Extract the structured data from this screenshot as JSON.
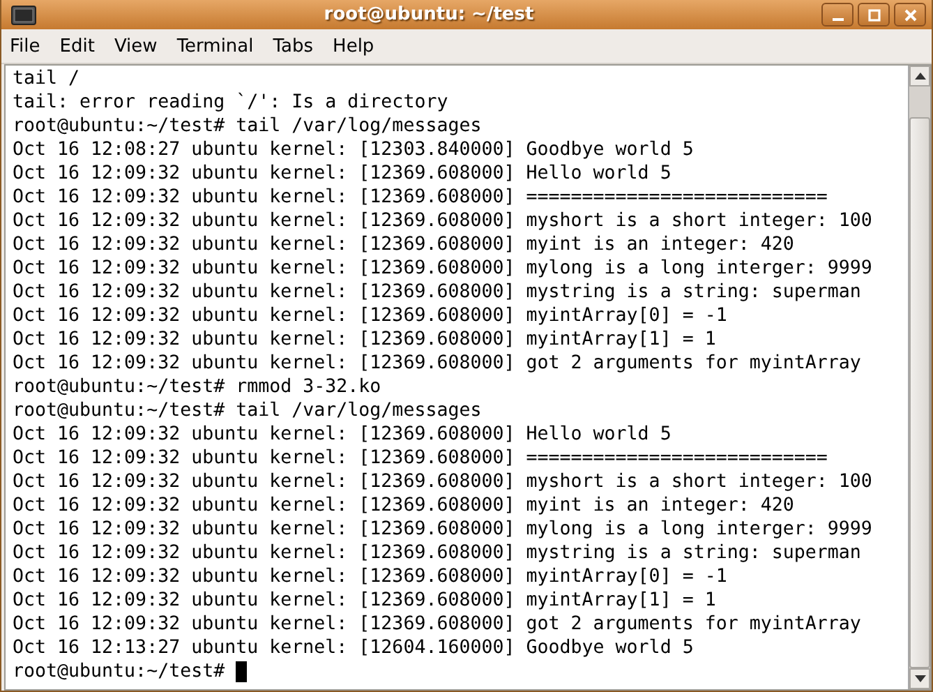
{
  "window": {
    "title": "root@ubuntu: ~/test"
  },
  "menu": [
    {
      "label": "File"
    },
    {
      "label": "Edit"
    },
    {
      "label": "View"
    },
    {
      "label": "Terminal"
    },
    {
      "label": "Tabs"
    },
    {
      "label": "Help"
    }
  ],
  "terminal": {
    "lines": [
      "tail /",
      "tail: error reading `/': Is a directory",
      "root@ubuntu:~/test# tail /var/log/messages",
      "Oct 16 12:08:27 ubuntu kernel: [12303.840000] Goodbye world 5",
      "Oct 16 12:09:32 ubuntu kernel: [12369.608000] Hello world 5",
      "Oct 16 12:09:32 ubuntu kernel: [12369.608000] ===========================",
      "Oct 16 12:09:32 ubuntu kernel: [12369.608000] myshort is a short integer: 100",
      "Oct 16 12:09:32 ubuntu kernel: [12369.608000] myint is an integer: 420",
      "Oct 16 12:09:32 ubuntu kernel: [12369.608000] mylong is a long interger: 9999",
      "Oct 16 12:09:32 ubuntu kernel: [12369.608000] mystring is a string: superman",
      "Oct 16 12:09:32 ubuntu kernel: [12369.608000] myintArray[0] = -1",
      "Oct 16 12:09:32 ubuntu kernel: [12369.608000] myintArray[1] = 1",
      "Oct 16 12:09:32 ubuntu kernel: [12369.608000] got 2 arguments for myintArray",
      "root@ubuntu:~/test# rmmod 3-32.ko",
      "root@ubuntu:~/test# tail /var/log/messages",
      "Oct 16 12:09:32 ubuntu kernel: [12369.608000] Hello world 5",
      "Oct 16 12:09:32 ubuntu kernel: [12369.608000] ===========================",
      "Oct 16 12:09:32 ubuntu kernel: [12369.608000] myshort is a short integer: 100",
      "Oct 16 12:09:32 ubuntu kernel: [12369.608000] myint is an integer: 420",
      "Oct 16 12:09:32 ubuntu kernel: [12369.608000] mylong is a long interger: 9999",
      "Oct 16 12:09:32 ubuntu kernel: [12369.608000] mystring is a string: superman",
      "Oct 16 12:09:32 ubuntu kernel: [12369.608000] myintArray[0] = -1",
      "Oct 16 12:09:32 ubuntu kernel: [12369.608000] myintArray[1] = 1",
      "Oct 16 12:09:32 ubuntu kernel: [12369.608000] got 2 arguments for myintArray",
      "Oct 16 12:13:27 ubuntu kernel: [12604.160000] Goodbye world 5"
    ],
    "prompt": "root@ubuntu:~/test#"
  }
}
